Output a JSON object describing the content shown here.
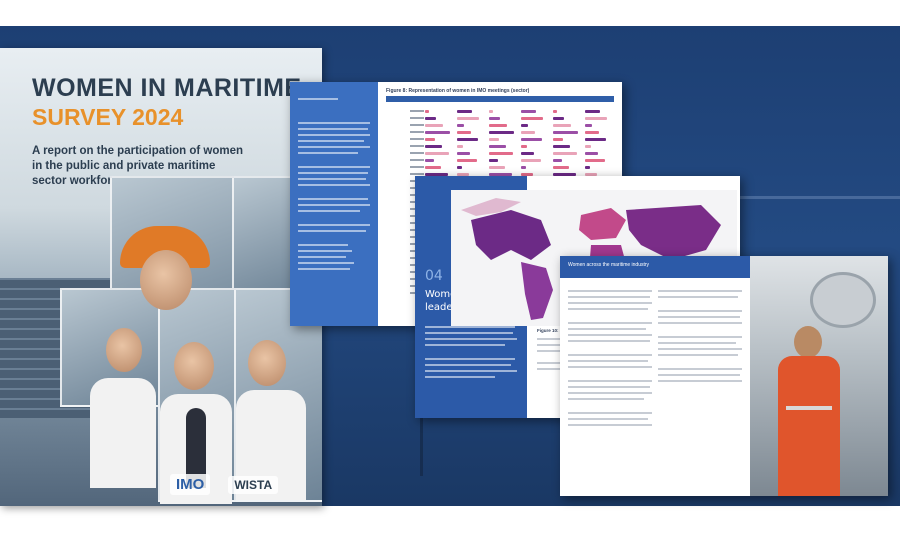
{
  "cover": {
    "title": "WOMEN IN MARITIME",
    "year_line": "SURVEY 2024",
    "description": "A report on the participation of women in the public and private maritime sector workforces",
    "logo_imo": "IMO",
    "logo_wista": "WISTA"
  },
  "spread_chart": {
    "figure_title": "Figure 8: Representation of women in IMO meetings (sector)"
  },
  "spread_map": {
    "section_number": "04",
    "section_title_line1": "Women in",
    "section_title_line2": "leadership",
    "caption": "Figure 10: Share of women as leaders"
  },
  "spread_photo": {
    "section_title": "Women across the maritime industry"
  },
  "colors": {
    "backdrop": "#1d3f73",
    "cover_orange": "#e8912a",
    "cover_navy": "#2c3e50",
    "page_blue": "#2c5aa8",
    "chart_pink": "#e26b8a",
    "chart_purple": "#6c2a86"
  }
}
